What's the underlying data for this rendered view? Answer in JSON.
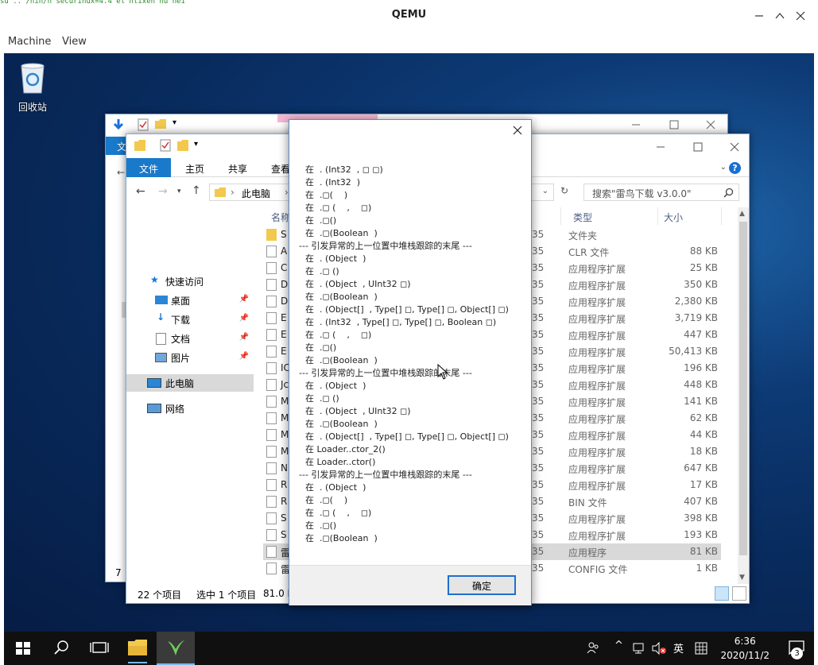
{
  "qemu": {
    "title": "QEMU",
    "menu": [
      "Machine",
      "View"
    ],
    "ghost_text": "su  ..  /nin/n  securinux=4.4 el  ntixen nu  nei"
  },
  "desktop": {
    "recycle_bin": "回收站"
  },
  "back_window": {
    "tab": "文",
    "status": "7"
  },
  "explorer": {
    "ribbon_tabs": [
      "文件",
      "主页",
      "共享",
      "查看"
    ],
    "address": "此电脑",
    "search_placeholder": "搜索\"雷鸟下载 v3.0.0\"",
    "nav": {
      "quick_access": "快速访问",
      "desktop": "桌面",
      "downloads": "下载",
      "documents": "文档",
      "pictures": "图片",
      "this_pc": "此电脑",
      "network": "网络"
    },
    "columns": {
      "name": "名称",
      "type": "类型",
      "size": "大小"
    },
    "files": [
      {
        "name": "S",
        "date": "35",
        "type": "文件夹",
        "size": ""
      },
      {
        "name": "A",
        "date": "35",
        "type": "CLR 文件",
        "size": "88 KB"
      },
      {
        "name": "C",
        "date": "35",
        "type": "应用程序扩展",
        "size": "25 KB"
      },
      {
        "name": "D",
        "date": "35",
        "type": "应用程序扩展",
        "size": "350 KB"
      },
      {
        "name": "D",
        "date": "35",
        "type": "应用程序扩展",
        "size": "2,380 KB"
      },
      {
        "name": "E",
        "date": "35",
        "type": "应用程序扩展",
        "size": "3,719 KB"
      },
      {
        "name": "E",
        "date": "35",
        "type": "应用程序扩展",
        "size": "447 KB"
      },
      {
        "name": "E",
        "date": "35",
        "type": "应用程序扩展",
        "size": "50,413 KB"
      },
      {
        "name": "IC",
        "date": "35",
        "type": "应用程序扩展",
        "size": "196 KB"
      },
      {
        "name": "Jc",
        "date": "35",
        "type": "应用程序扩展",
        "size": "448 KB"
      },
      {
        "name": "M",
        "date": "35",
        "type": "应用程序扩展",
        "size": "141 KB"
      },
      {
        "name": "M",
        "date": "35",
        "type": "应用程序扩展",
        "size": "62 KB"
      },
      {
        "name": "M",
        "date": "35",
        "type": "应用程序扩展",
        "size": "44 KB"
      },
      {
        "name": "M",
        "date": "35",
        "type": "应用程序扩展",
        "size": "18 KB"
      },
      {
        "name": "N",
        "date": "35",
        "type": "应用程序扩展",
        "size": "647 KB"
      },
      {
        "name": "R",
        "date": "35",
        "type": "应用程序扩展",
        "size": "17 KB"
      },
      {
        "name": "R",
        "date": "35",
        "type": "BIN 文件",
        "size": "407 KB"
      },
      {
        "name": "S",
        "date": "35",
        "type": "应用程序扩展",
        "size": "398 KB"
      },
      {
        "name": "S",
        "date": "35",
        "type": "应用程序扩展",
        "size": "193 KB"
      },
      {
        "name": "雷",
        "date": "35",
        "type": "应用程序",
        "size": "81 KB"
      },
      {
        "name": "雷",
        "date": "35",
        "type": "CONFIG 文件",
        "size": "1 KB"
      }
    ],
    "status": {
      "count": "22 个项目",
      "selected": "选中 1 个项目",
      "size": "81.0 K"
    }
  },
  "dialog": {
    "ok": "确定",
    "lines": [
      "在  . (Int32  , ◻ ◻)",
      "在  . (Int32  )",
      "在  .◻(    )",
      "在  .◻ (    ,    ◻)",
      "在  .◻()",
      "在  .◻(Boolean  )",
      "--- 引发异常的上一位置中堆栈跟踪的末尾 ---",
      "在  . (Object  )",
      "在  .◻ ()",
      "在  . (Object  , UInt32 ◻)",
      "在  .◻(Boolean  )",
      "在  . (Object[]  , Type[] ◻, Type[] ◻, Object[] ◻)",
      "在  . (Int32  , Type[] ◻, Type[] ◻, Boolean ◻)",
      "在  .◻ (    ,    ◻)",
      "在  .◻()",
      "在  .◻(Boolean  )",
      "--- 引发异常的上一位置中堆栈跟踪的末尾 ---",
      "在  . (Object  )",
      "在  .◻ ()",
      "在  . (Object  , UInt32 ◻)",
      "在  .◻(Boolean  )",
      "在  . (Object[]  , Type[] ◻, Type[] ◻, Object[] ◻)",
      "在 Loader..ctor_2()",
      "在 Loader..ctor()",
      "--- 引发异常的上一位置中堆栈跟踪的末尾 ---",
      "在  . (Object  )",
      "在  .◻(    )",
      "在  .◻ (    ,    ◻)",
      "在  .◻()",
      "在  .◻(Boolean  )"
    ]
  },
  "taskbar": {
    "ime": "英",
    "time": "6:36",
    "date": "2020/11/2",
    "notifications": "3"
  },
  "colors": {
    "accent": "#1979ca",
    "taskbar": "#101010",
    "selected_row": "#d9d9d9"
  }
}
